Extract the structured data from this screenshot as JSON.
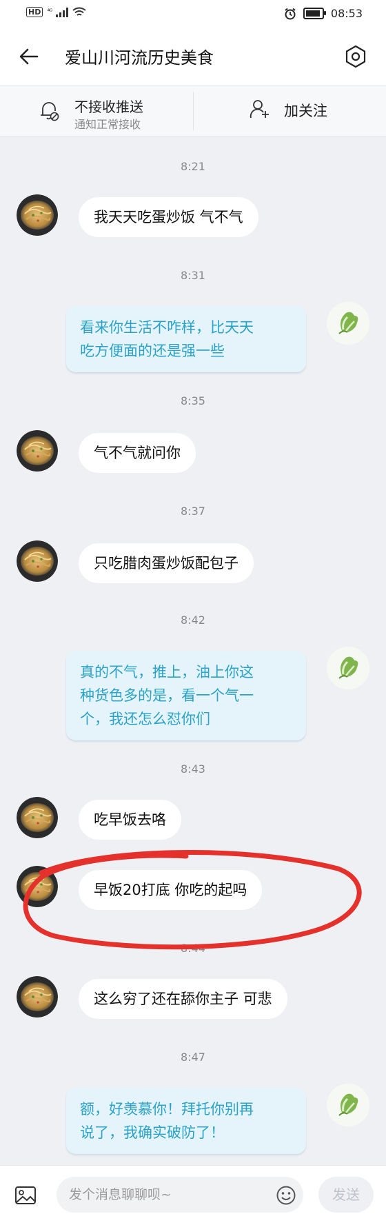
{
  "status_bar": {
    "hd": "HD",
    "signal": "⁴ᴳ",
    "time": "08:53",
    "battery_level": 0.9
  },
  "header": {
    "title": "爱山川河流历史美食"
  },
  "actions": {
    "push_title": "不接收推送",
    "push_sub": "通知正常接收",
    "follow": "加关注"
  },
  "messages": [
    {
      "time": "8:21",
      "from": "other",
      "text": "我天天吃蛋炒饭 气不气"
    },
    {
      "time": "8:31",
      "from": "self",
      "lines": [
        "看来你生活不咋样，比天天",
        "吃方便面的还是强一些"
      ]
    },
    {
      "time": "8:35",
      "from": "other",
      "text": "气不气就问你"
    },
    {
      "time": "8:37",
      "from": "other",
      "text": "只吃腊肉蛋炒饭配包子"
    },
    {
      "time": "8:42",
      "from": "self",
      "lines": [
        "真的不气，推上，油上你这",
        "种货色多的是，看一个气一",
        "个，我还怎么怼你们"
      ]
    },
    {
      "time": "8:43",
      "from": "other",
      "text": "吃早饭去咯"
    },
    {
      "time": "",
      "from": "other",
      "text": "早饭20打底 你吃的起吗"
    },
    {
      "time": "8:44",
      "from": "other",
      "text": "这么穷了还在舔你主子 可悲"
    },
    {
      "time": "8:47",
      "from": "self",
      "lines": [
        "额，好羡慕你！拜托你别再",
        "说了，我确实破防了！"
      ]
    }
  ],
  "annotation_color": "#e5312b",
  "input": {
    "placeholder": "发个消息聊聊呗~",
    "send": "发送"
  },
  "colors": {
    "self_text": "#2aa2c9",
    "self_bubble": "#e5f4fb",
    "background": "#eef0f3"
  }
}
